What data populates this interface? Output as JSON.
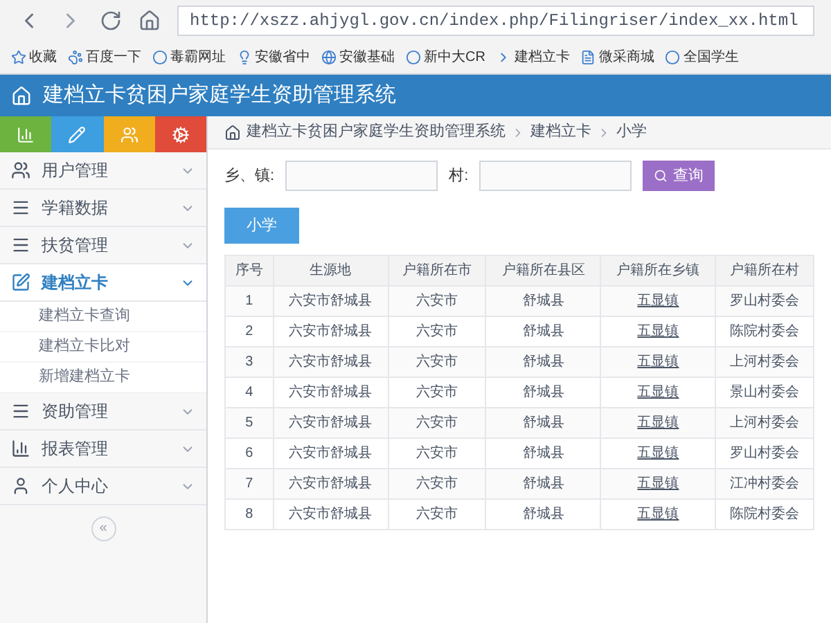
{
  "browser": {
    "url": "http://xszz.ahjygl.gov.cn/index.php/Filingriser/index_xx.html",
    "bookmarks": [
      {
        "label": "收藏",
        "kind": "star"
      },
      {
        "label": "百度一下",
        "kind": "paw"
      },
      {
        "label": "毒霸网址",
        "kind": "k"
      },
      {
        "label": "安徽省中",
        "kind": "bulb"
      },
      {
        "label": "安徽基础",
        "kind": "c"
      },
      {
        "label": "新中大CR",
        "kind": "dots"
      },
      {
        "label": "建档立卡",
        "kind": "x"
      },
      {
        "label": "微采商城",
        "kind": "page"
      },
      {
        "label": "全国学生",
        "kind": "seal"
      }
    ]
  },
  "header": {
    "title": "建档立卡贫困户家庭学生资助管理系统"
  },
  "shortcuts": [
    {
      "kind": "chart",
      "color": "#6cb33f"
    },
    {
      "kind": "pencil",
      "color": "#3d9ee0"
    },
    {
      "kind": "users",
      "color": "#f0ad1e"
    },
    {
      "kind": "cogs",
      "color": "#e04b3a"
    }
  ],
  "sidebar": {
    "items": [
      {
        "label": "用户管理",
        "kind": "users",
        "expanded": false,
        "selected": false
      },
      {
        "label": "学籍数据",
        "kind": "bars",
        "expanded": false,
        "selected": false
      },
      {
        "label": "扶贫管理",
        "kind": "bars",
        "expanded": false,
        "selected": false
      },
      {
        "label": "建档立卡",
        "kind": "edit",
        "expanded": true,
        "selected": true,
        "children": [
          {
            "label": "建档立卡查询"
          },
          {
            "label": "建档立卡比对"
          },
          {
            "label": "新增建档立卡"
          }
        ]
      },
      {
        "label": "资助管理",
        "kind": "bars",
        "expanded": false,
        "selected": false
      },
      {
        "label": "报表管理",
        "kind": "chart",
        "expanded": false,
        "selected": false
      },
      {
        "label": "个人中心",
        "kind": "user",
        "expanded": false,
        "selected": false
      }
    ],
    "collapse": "«"
  },
  "breadcrumb": [
    "建档立卡贫困户家庭学生资助管理系统",
    "建档立卡",
    "小学"
  ],
  "search": {
    "fields": [
      {
        "label": "乡、镇:"
      },
      {
        "label": "村:"
      }
    ],
    "button": "查询"
  },
  "tabs": [
    {
      "label": "小学",
      "selected": true
    }
  ],
  "table": {
    "columns": [
      "序号",
      "生源地",
      "户籍所在市",
      "户籍所在县区",
      "户籍所在乡镇",
      "户籍所在村"
    ],
    "rows": [
      [
        "1",
        "六安市舒城县",
        "六安市",
        "舒城县",
        "五显镇",
        "罗山村委会"
      ],
      [
        "2",
        "六安市舒城县",
        "六安市",
        "舒城县",
        "五显镇",
        "陈院村委会"
      ],
      [
        "3",
        "六安市舒城县",
        "六安市",
        "舒城县",
        "五显镇",
        "上河村委会"
      ],
      [
        "4",
        "六安市舒城县",
        "六安市",
        "舒城县",
        "五显镇",
        "景山村委会"
      ],
      [
        "5",
        "六安市舒城县",
        "六安市",
        "舒城县",
        "五显镇",
        "上河村委会"
      ],
      [
        "6",
        "六安市舒城县",
        "六安市",
        "舒城县",
        "五显镇",
        "罗山村委会"
      ],
      [
        "7",
        "六安市舒城县",
        "六安市",
        "舒城县",
        "五显镇",
        "江冲村委会"
      ],
      [
        "8",
        "六安市舒城县",
        "六安市",
        "舒城县",
        "五显镇",
        "陈院村委会"
      ]
    ]
  }
}
